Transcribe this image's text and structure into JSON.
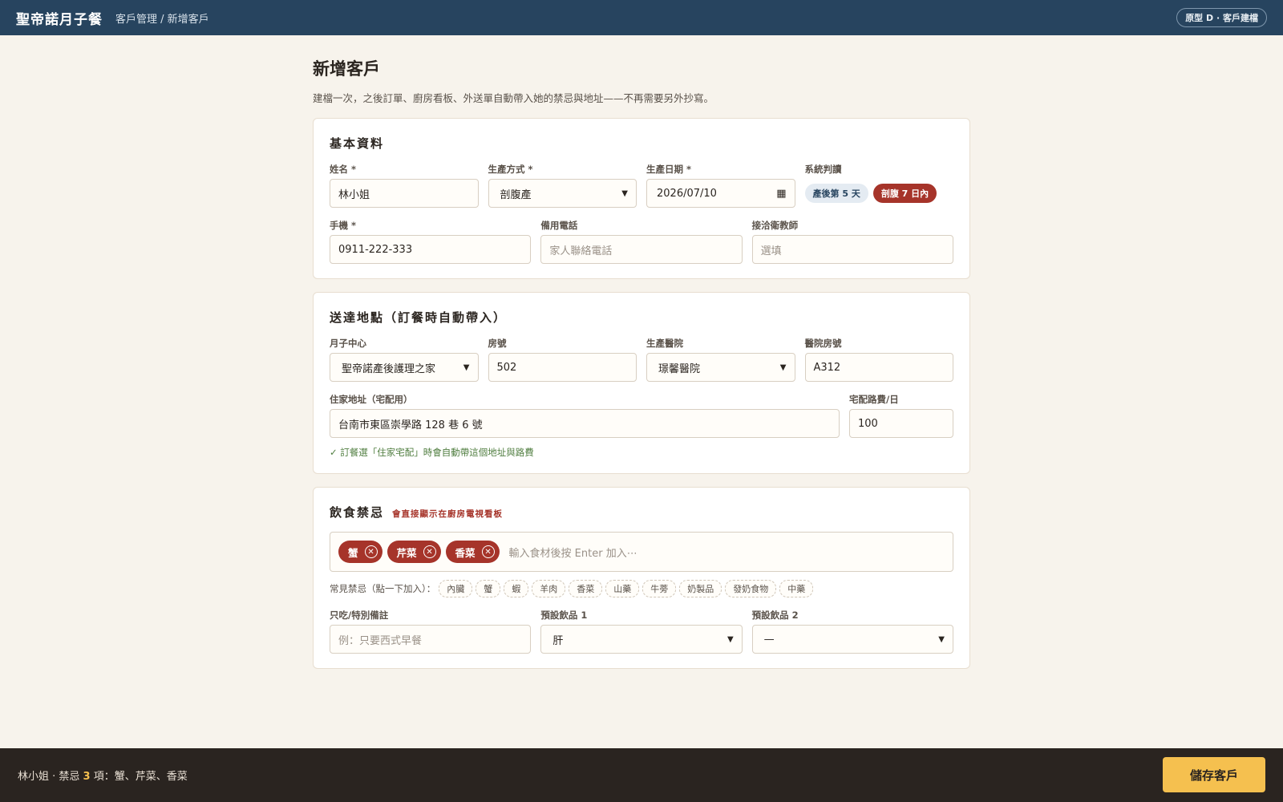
{
  "header": {
    "brand": "聖帝諾月子餐",
    "breadcrumb": "客戶管理 / 新增客戶",
    "prototype_badge": "原型 D · 客戶建檔"
  },
  "page": {
    "title": "新增客戶",
    "subtitle": "建檔一次，之後訂單、廚房看板、外送單自動帶入她的禁忌與地址——不再需要另外抄寫。"
  },
  "basic": {
    "title": "基本資料",
    "name_label": "姓名 *",
    "name_value": "林小姐",
    "birth_method_label": "生產方式 *",
    "birth_method_value": "剖腹產",
    "birth_date_label": "生產日期 *",
    "birth_date_value": "2026/07/10",
    "system_label": "系統判讀",
    "badge_days": "產後第 5 天",
    "badge_csection": "剖腹 7 日內",
    "phone_label": "手機 *",
    "phone_value": "0911-222-333",
    "alt_phone_label": "備用電話",
    "alt_phone_placeholder": "家人聯絡電話",
    "educator_label": "接洽衛教師",
    "educator_placeholder": "選填"
  },
  "delivery": {
    "title": "送達地點（訂餐時自動帶入）",
    "center_label": "月子中心",
    "center_value": "聖帝諾產後護理之家",
    "room_label": "房號",
    "room_value": "502",
    "hospital_label": "生產醫院",
    "hospital_value": "璟馨醫院",
    "hospital_room_label": "醫院房號",
    "hospital_room_value": "A312",
    "address_label": "住家地址（宅配用）",
    "address_value": "台南市東區崇學路 128 巷 6 號",
    "fee_label": "宅配路費/日",
    "fee_value": "100",
    "hint": "✓ 訂餐選「住家宅配」時會自動帶這個地址與路費"
  },
  "diet": {
    "title": "飲食禁忌",
    "note": "會直接顯示在廚房電視看板",
    "tags": [
      "蟹",
      "芹菜",
      "香菜"
    ],
    "tag_input_placeholder": "輸入食材後按 Enter 加入⋯",
    "common_label": "常見禁忌（點一下加入）：",
    "common": [
      "內臟",
      "蟹",
      "蝦",
      "羊肉",
      "香菜",
      "山藥",
      "牛蒡",
      "奶製品",
      "發奶食物",
      "中藥"
    ],
    "special_label": "只吃/特別備註",
    "special_placeholder": "例：只要西式早餐",
    "drink1_label": "預設飲品 1",
    "drink1_value": "肝",
    "drink2_label": "預設飲品 2",
    "drink2_value": "—"
  },
  "footer": {
    "summary_name": "林小姐",
    "summary_prefix": " · 禁忌 ",
    "summary_count": "3",
    "summary_suffix": " 項：蟹、芹菜、香菜",
    "save_label": "儲存客戶"
  }
}
